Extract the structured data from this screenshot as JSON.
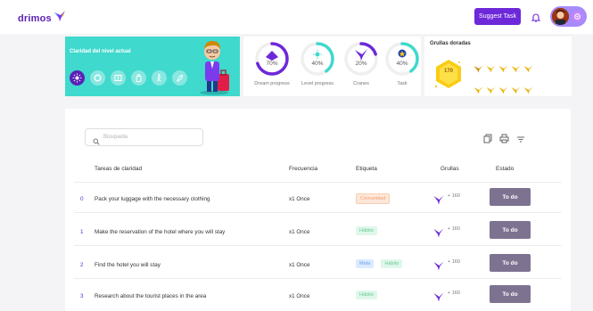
{
  "header": {
    "logo_text": "drimos",
    "suggest_label": "Suggest Task",
    "icons": [
      "bird-logo-icon",
      "bell-icon",
      "gear-icon"
    ]
  },
  "level": {
    "title": "Claridad del nivel actual",
    "icons": [
      "sun-icon",
      "circle-icon",
      "book-icon",
      "bag-icon",
      "walk-icon",
      "rocket-icon"
    ],
    "bg_color": "#3fd9cd"
  },
  "progress": [
    {
      "label": "Dream progress",
      "value": "70%",
      "fraction": 0.7,
      "color": "#6d28d9"
    },
    {
      "label": "Level progress",
      "value": "40%",
      "fraction": 0.4,
      "color": "#3fd9cd"
    },
    {
      "label": "Cranes",
      "value": "20%",
      "fraction": 0.2,
      "color": "#6d28d9"
    },
    {
      "label": "Task",
      "value": "40%",
      "fraction": 0.4,
      "color": "#3fd9cd"
    }
  ],
  "grullas": {
    "title": "Grullas doradas",
    "count": "170"
  },
  "search": {
    "placeholder": "Búsqueda"
  },
  "table": {
    "headers": {
      "task": "Tareas de claridad",
      "freq": "Frecuencia",
      "tag": "Etiqueta",
      "cranes": "Grullas",
      "status": "Estado"
    },
    "rows": [
      {
        "idx": "0",
        "task": "Pack your luggage with the necessary clothing",
        "freq": "x1 Once",
        "tags": [
          {
            "text": "Comunidad",
            "style": "orange"
          }
        ],
        "points": "+ 160",
        "status": "To do"
      },
      {
        "idx": "1",
        "task": "Make the reservation of the hotel where you will stay",
        "freq": "x1 Once",
        "tags": [
          {
            "text": "Hábito",
            "style": "green"
          }
        ],
        "points": "+ 160",
        "status": "To do"
      },
      {
        "idx": "2",
        "task": "Find the hotel you will stay",
        "freq": "x1 Once",
        "tags": [
          {
            "text": "Meta",
            "style": "blue"
          },
          {
            "text": "Hábito",
            "style": "green"
          }
        ],
        "points": "+ 160",
        "status": "To do"
      },
      {
        "idx": "3",
        "task": "Research about the tourist places in the area",
        "freq": "x1 Once",
        "tags": [
          {
            "text": "Hábito",
            "style": "green"
          }
        ],
        "points": "+ 160",
        "status": "To do"
      }
    ]
  },
  "colors": {
    "brand": "#6d28d9",
    "teal": "#3fd9cd",
    "todo": "#7d7290"
  }
}
